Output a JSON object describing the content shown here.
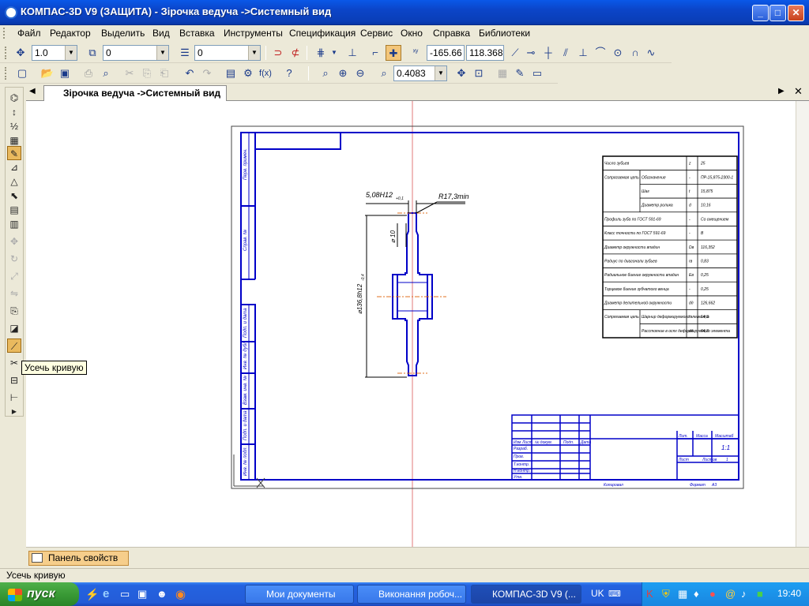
{
  "window": {
    "title": "КОМПАС-3D V9 (ЗАЩИТА) - Зірочка ведуча ->Системный вид"
  },
  "menu": [
    "Файл",
    "Редактор",
    "Выделить",
    "Вид",
    "Вставка",
    "Инструменты",
    "Спецификация",
    "Сервис",
    "Окно",
    "Справка",
    "Библиотеки"
  ],
  "toolbar1": {
    "scale_value": "1.0",
    "layer_value": "0",
    "style_value": "0",
    "coord_x": "-165.66",
    "coord_y": "118.368"
  },
  "toolbar2": {
    "zoom_value": "0.4083"
  },
  "document": {
    "tab_label": "Зірочка ведуча ->Системный вид"
  },
  "tooltip": "Усечь кривую",
  "property_panel": {
    "tab_label": "Панель свойств"
  },
  "status": {
    "text": "Усечь кривую"
  },
  "taskbar": {
    "start_label": "пуск",
    "tasks": [
      "Мои документы",
      "Виконання робоч...",
      "КОМПАС-3D V9 (..."
    ],
    "language": "UK",
    "clock": "19:40"
  },
  "drawing": {
    "dim_top": "5,08H12",
    "dim_top_sub": "+0,1",
    "dim_radius": "R17,3min",
    "dim_side": "⌀ 10",
    "dim_dia": "⌀136,8h12",
    "dim_dia_sub": "-0,4",
    "table_rows": [
      {
        "label": "Число зубьев",
        "sym": "z",
        "val": "25"
      },
      {
        "label": "Сопрягаемая цепь",
        "sub": "Обозначение",
        "sym": "-",
        "val": "ПР-15,875-2300-1"
      },
      {
        "label": "",
        "sub": "Шаг",
        "sym": "t",
        "val": "15,875"
      },
      {
        "label": "",
        "sub": "Диаметр ролика",
        "sym": "d",
        "val": "10,16"
      },
      {
        "label": "Профиль зуба по ГОСТ 591-69",
        "sym": "-",
        "val": "Со смещением"
      },
      {
        "label": "Класс точности по ГОСТ 591-69",
        "sym": "-",
        "val": "В"
      },
      {
        "label": "Диаметр окружности впадин",
        "sym": "Dв",
        "val": "116,352"
      },
      {
        "label": "Радиус по диагонали зубьев",
        "sym": "rв",
        "val": "0,83"
      },
      {
        "label": "Радиальное биение окружности впадин",
        "sym": "Eв",
        "val": "0,25"
      },
      {
        "label": "Торцевое биение зубчатого венца",
        "sym": "-",
        "val": "0,25"
      },
      {
        "label": "Диаметр делительной окружности",
        "sym": "dд",
        "val": "126,662"
      },
      {
        "label": "Сопрягаемая цепь",
        "sub": "Шарнир деформируемого элемента",
        "sym": "h",
        "val": "14,3"
      },
      {
        "label": "",
        "sub": "Расстояние в осях деформируемого элемента",
        "sym": "dд",
        "val": "64,3"
      }
    ],
    "stamp": {
      "col_heads": [
        "Изм",
        "Лист",
        "№ докум.",
        "Подп.",
        "Дата"
      ],
      "rows": [
        "Разраб.",
        "Пров.",
        "Т.контр.",
        "Н.контр.",
        "Утв."
      ],
      "lit_head": "Лит.",
      "mass_head": "Масса",
      "scale_head": "Масштаб",
      "scale_value": "1:1",
      "sheet": "Лист",
      "sheets": "Листов",
      "sheets_count": "1",
      "copied": "Копировал",
      "format": "Формат",
      "format_value": "А3"
    },
    "frame_left_labels": [
      "Перв. примен.",
      "Справ. №",
      "Подп. и дата",
      "Инв. № дубл.",
      "Взам. инв. №",
      "Подп. и дата",
      "Инв. № подл."
    ]
  },
  "colors": {
    "drawing_line": "#0000c8",
    "axis_line": "#e05050",
    "xp_blue": "#0A3EB8"
  }
}
